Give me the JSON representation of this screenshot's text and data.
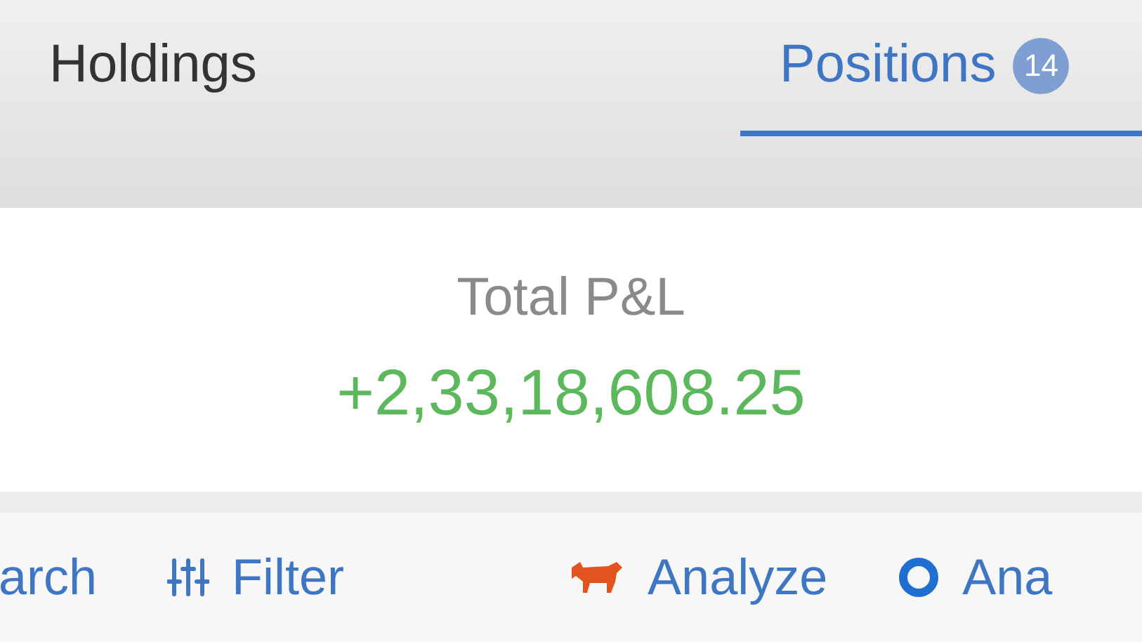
{
  "tabs": [
    {
      "label": "Holdings",
      "selected": false
    },
    {
      "label": "Positions",
      "selected": true,
      "badge": "14"
    }
  ],
  "summary": {
    "label": "Total P&L",
    "value": "+2,33,18,608.25"
  },
  "toolbar": [
    {
      "kind": "search",
      "label": "arch"
    },
    {
      "kind": "filter",
      "label": "Filter"
    },
    {
      "kind": "bull",
      "label": "Analyze"
    },
    {
      "kind": "ring",
      "label": "Ana"
    }
  ]
}
